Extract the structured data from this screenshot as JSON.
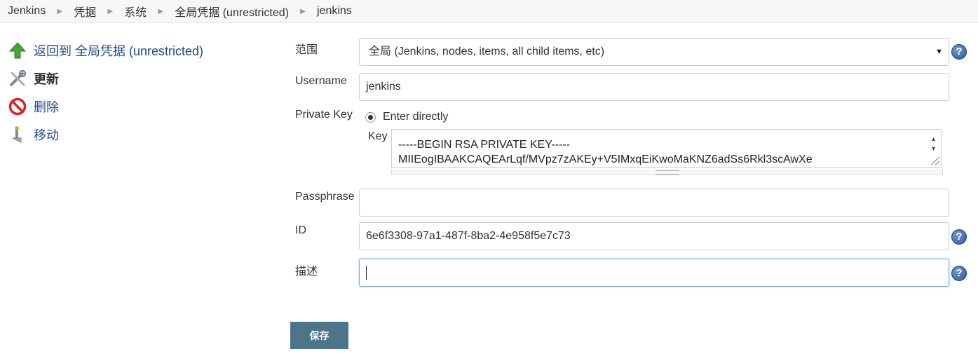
{
  "breadcrumb": [
    "Jenkins",
    "凭据",
    "系统",
    "全局凭据 (unrestricted)",
    "jenkins"
  ],
  "side": {
    "back": "返回到 全局凭据 (unrestricted)",
    "update": "更新",
    "delete": "删除",
    "move": "移动"
  },
  "form": {
    "scope_label": "范围",
    "scope_value": "全局 (Jenkins, nodes, items, all child items, etc)",
    "username_label": "Username",
    "username_value": "jenkins",
    "private_key_label": "Private Key",
    "enter_directly_label": "Enter directly",
    "key_label": "Key",
    "key_lines": [
      "-----BEGIN RSA PRIVATE KEY-----",
      "MIIEogIBAAKCAQEArLqf/MVpz7zAKEy+V5IMxqEiKwoMaKNZ6adSs6Rkl3scAwXe"
    ],
    "passphrase_label": "Passphrase",
    "passphrase_value": "",
    "id_label": "ID",
    "id_value": "6e6f3308-97a1-487f-8ba2-4e958f5e7c73",
    "description_label": "描述",
    "description_value": "",
    "help_glyph": "?",
    "save_label": "保存"
  },
  "colors": {
    "save_button": "#4b758b",
    "link": "#204a87",
    "help": "#2d5a9c",
    "focus_border": "#7aa7e6"
  },
  "icons": [
    "up-arrow-icon",
    "tools-icon",
    "prohibited-icon",
    "move-icon",
    "help-icon",
    "chevron-right-icon"
  ]
}
